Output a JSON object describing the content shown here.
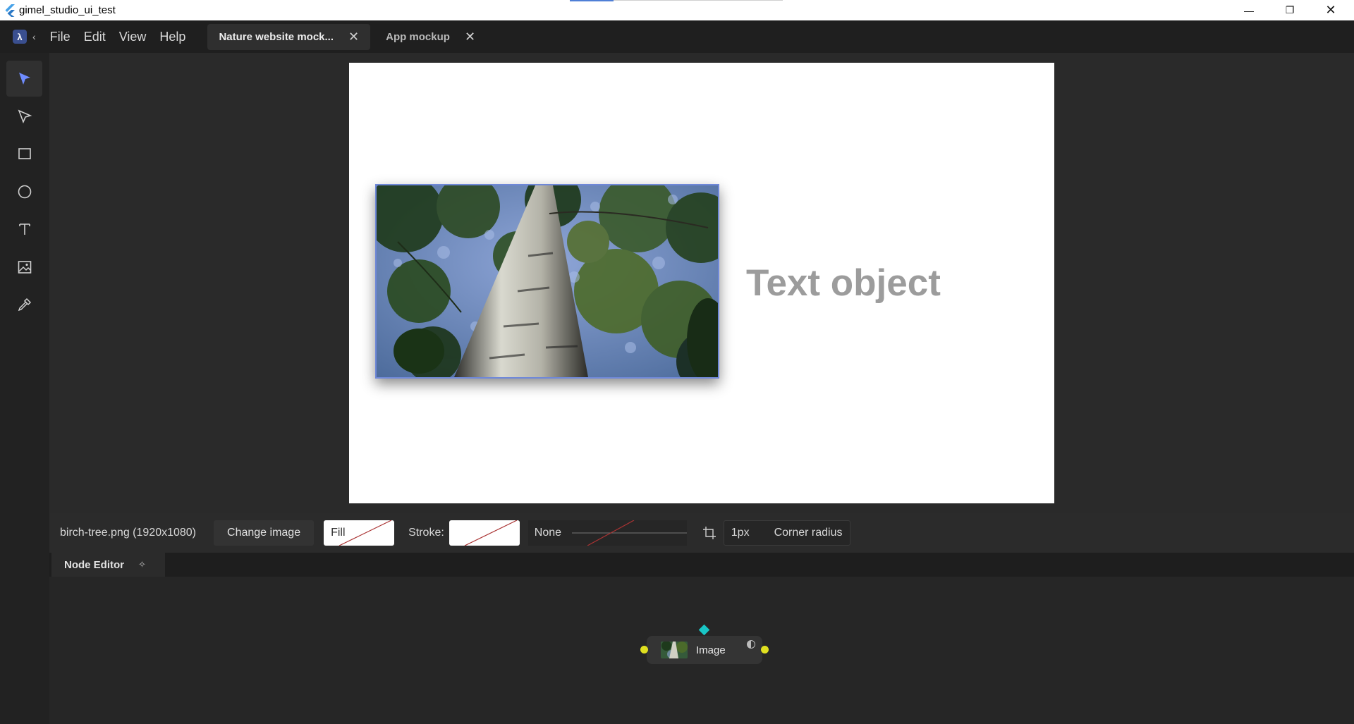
{
  "window": {
    "title": "gimel_studio_ui_test",
    "controls": {
      "minimize": "—",
      "maximize": "❐",
      "close": "✕"
    }
  },
  "menubar": {
    "logo_glyph": "λ",
    "back_chevron": "‹",
    "menus": [
      "File",
      "Edit",
      "View",
      "Help"
    ],
    "tabs": [
      {
        "label": "Nature website mock...",
        "active": true,
        "close": "✕"
      },
      {
        "label": "App mockup",
        "active": false,
        "close": "✕"
      }
    ]
  },
  "toolbar": {
    "tools": [
      {
        "name": "select-tool",
        "icon": "pointer-arrow-icon",
        "active": true
      },
      {
        "name": "node-select-tool",
        "icon": "node-pointer-icon",
        "active": false
      },
      {
        "name": "rectangle-tool",
        "icon": "rectangle-icon",
        "active": false
      },
      {
        "name": "ellipse-tool",
        "icon": "circle-icon",
        "active": false
      },
      {
        "name": "text-tool",
        "icon": "text-icon",
        "active": false
      },
      {
        "name": "image-tool",
        "icon": "image-icon",
        "active": false
      },
      {
        "name": "eyedropper-tool",
        "icon": "eyedropper-icon",
        "active": false
      }
    ],
    "accent_color": "#6f8cff"
  },
  "canvas": {
    "text_object": "Text object",
    "text_color": "#9c9c9c",
    "selection_color": "#6f88d8"
  },
  "properties": {
    "file_label": "birch-tree.png (1920x1080)",
    "change_image_button": "Change image",
    "fill_label": "Fill",
    "stroke_label": "Stroke:",
    "stroke_style": "None",
    "stroke_width": "1px",
    "corner_radius_label": "Corner radius"
  },
  "node_editor": {
    "tab_label": "Node Editor",
    "pin_glyph": "✧",
    "node_label": "Image",
    "socket_color": "#e0e020",
    "diamond_color": "#19c6c6"
  }
}
